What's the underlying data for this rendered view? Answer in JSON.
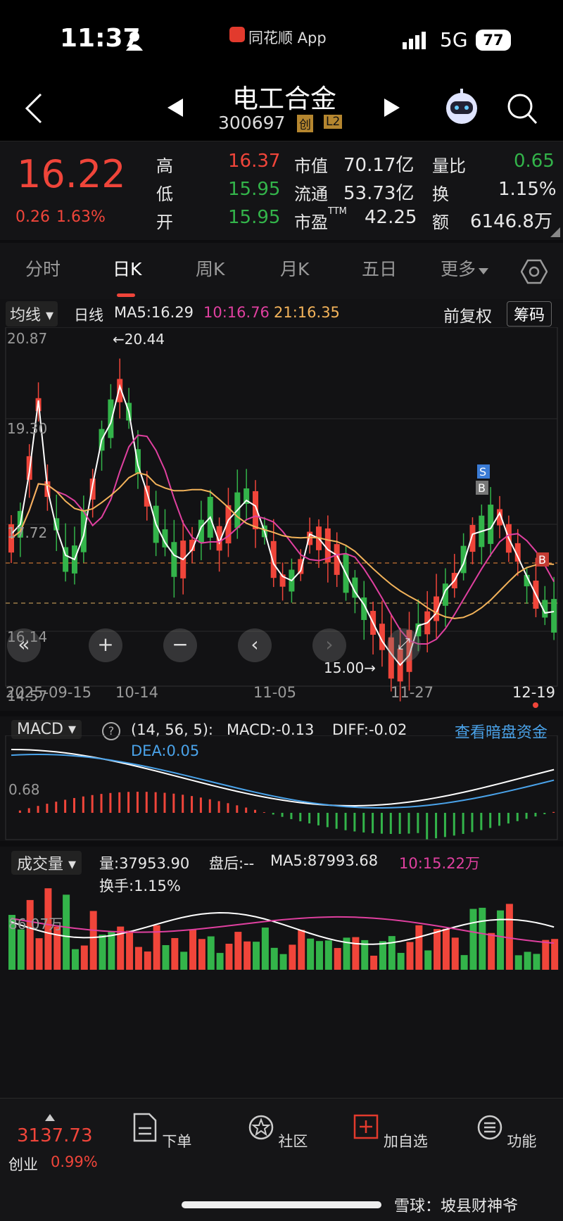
{
  "status": {
    "time": "11:37",
    "app_name": "同花顺 App",
    "network": "5G",
    "battery": "77"
  },
  "header": {
    "stock_name": "电工合金",
    "stock_code": "300697",
    "badge_board": "创",
    "badge_level": "L2"
  },
  "quote": {
    "price": "16.22",
    "change": "0.26",
    "change_pct": "1.63%",
    "high_label": "高",
    "high": "16.37",
    "low_label": "低",
    "low": "15.95",
    "open_label": "开",
    "open": "15.95",
    "mktcap_label": "市值",
    "mktcap": "70.17亿",
    "float_label": "流通",
    "float": "53.73亿",
    "pe_label": "市盈",
    "pe_suffix": "TTM",
    "pe": "42.25",
    "vol_ratio_label": "量比",
    "vol_ratio": "0.65",
    "turnover_label": "换",
    "turnover": "1.15%",
    "amount_label": "额",
    "amount": "6146.8万"
  },
  "tabs": [
    "分时",
    "日K",
    "周K",
    "月K",
    "五日",
    "更多"
  ],
  "kline": {
    "ma_selector": "均线",
    "period": "日线",
    "ma5": "MA5:16.29",
    "ma10": "10:16.76",
    "ma21": "21:16.35",
    "adjust": "前复权",
    "chips": "筹码",
    "y_top": "20.87",
    "y_2": "19.30",
    "y_3": "17.72",
    "y_4": "16.14",
    "y_bottom": "14.57",
    "max_marker": "←20.44",
    "min_marker": "15.00→",
    "dates": [
      "2025-09-15",
      "10-14",
      "11-05",
      "11-27",
      "12-19"
    ],
    "signal_s": "S",
    "signal_b": "B"
  },
  "macd": {
    "selector": "MACD",
    "params": "(14, 56, 5):",
    "macd": "MACD:-0.13",
    "diff": "DIFF:-0.02",
    "dea": "DEA:0.05",
    "dark_pool_link": "查看暗盘资金",
    "axis_label": "0.68"
  },
  "volume": {
    "selector": "成交量",
    "vol": "量:37953.90",
    "after_hours": "盘后:--",
    "ma5": "MA5:87993.68",
    "ma10": "10:15.22万",
    "turnover": "换手:1.15%",
    "axis_label": "86.07万"
  },
  "bottom": {
    "index_value": "3137.73",
    "index_name": "创业",
    "index_pct": "0.99%",
    "order": "下单",
    "community": "社区",
    "add_fav": "加自选",
    "functions": "功能",
    "watermark": "雪球：坡县财神爷"
  },
  "colors": {
    "up": "#f0453a",
    "down": "#33b44a",
    "ma5": "#ffffff",
    "ma10": "#e040a0",
    "ma21": "#f3b35a",
    "dea": "#4aa3ea"
  }
}
